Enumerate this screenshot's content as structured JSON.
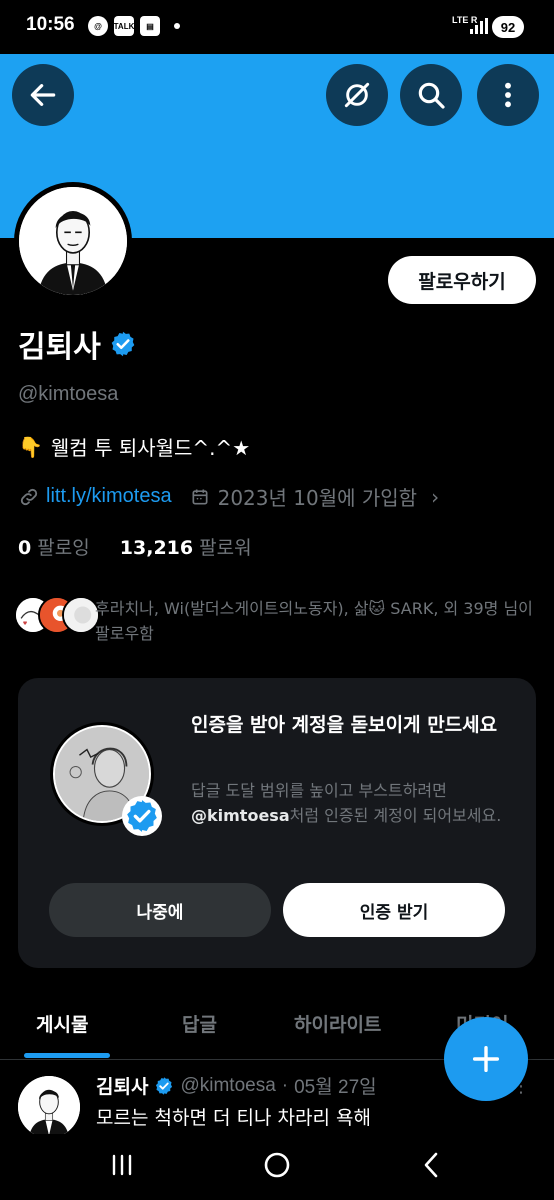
{
  "status_bar": {
    "time": "10:56",
    "talk_label": "TALK",
    "network": "LTE",
    "network_sub": "R",
    "battery": "92"
  },
  "profile": {
    "name": "김퇴사",
    "handle": "@kimtoesa",
    "bio_text": "웰컴 투 퇴사월드^.^★",
    "bio_emoji": "👇",
    "link": "litt.ly/kimotesa",
    "joined": "2023년 10월에 가입함",
    "following_count": "0",
    "following_label": "팔로잉",
    "followers_count": "13,216",
    "followers_label": "팔로워",
    "follow_button": "팔로우하기",
    "followed_by": "후라치나, Wi(발더스게이트의노동자), 삶🐱 SARK, 외 39명 님이 팔로우함"
  },
  "verify_card": {
    "title": "인증을 받아 계정을 돋보이게 만드세요",
    "desc_before": "답글 도달 범위를 높이고 부스트하려면 ",
    "desc_handle": "@kimtoesa",
    "desc_after": "처럼 인증된 계정이 되어보세요.",
    "later_button": "나중에",
    "verify_button": "인증 받기"
  },
  "tabs": [
    "게시물",
    "답글",
    "하이라이트",
    "미디어"
  ],
  "post": {
    "name": "김퇴사",
    "handle": "@kimtoesa",
    "separator": "·",
    "date": "05월 27일",
    "text": "모르는 척하면 더 티나 차라리 욕해"
  },
  "colors": {
    "banner": "#1da1f2",
    "accent": "#1d9bf0",
    "background": "#000000"
  }
}
